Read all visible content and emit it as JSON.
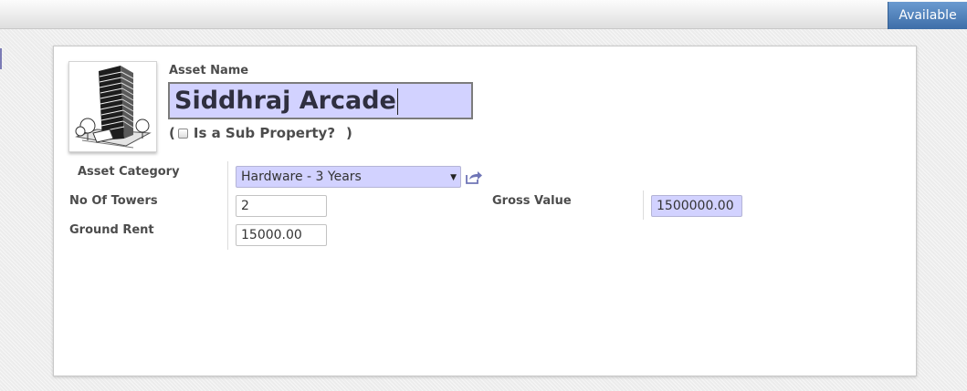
{
  "status": {
    "current": "Available"
  },
  "form": {
    "asset_name_label": "Asset Name",
    "asset_name_value": "Siddhraj Arcade",
    "sub_property": {
      "open_paren": "(",
      "label": "Is a Sub Property?",
      "close_paren": ")",
      "checked": false
    },
    "asset_category": {
      "label": "Asset Category",
      "value": "Hardware - 3 Years"
    },
    "no_of_towers": {
      "label": "No Of Towers",
      "value": "2"
    },
    "ground_rent": {
      "label": "Ground Rent",
      "value": "15000.00"
    },
    "gross_value": {
      "label": "Gross Value",
      "value": "1500000.00"
    }
  },
  "colors": {
    "accent": "#3e6ea8",
    "required_field": "#d2d2ff"
  }
}
